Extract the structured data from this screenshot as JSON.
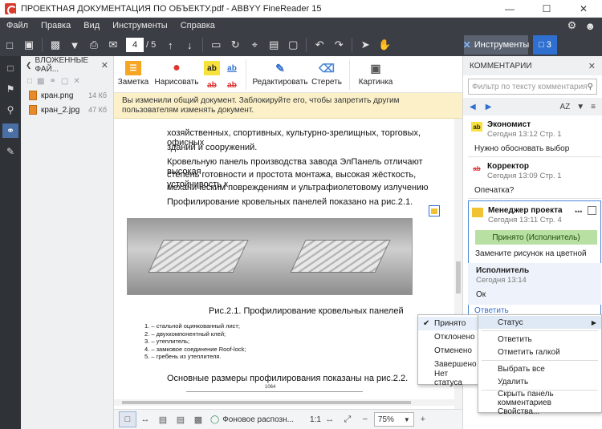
{
  "window": {
    "title": "ПРОЕКТНАЯ ДОКУМЕНТАЦИЯ ПО ОБЪЕКТУ.pdf - ABBYY FineReader 15",
    "minimize": "—",
    "maximize": "☐",
    "close": "✕"
  },
  "menu": {
    "items": [
      "Файл",
      "Правка",
      "Вид",
      "Инструменты",
      "Справка"
    ]
  },
  "toolbar": {
    "page_current": "4",
    "page_total": "/ 5",
    "tools_label": "Инструменты",
    "comments_count": "3"
  },
  "attachments": {
    "title": "ВЛОЖЕННЫЕ ФАЙ...",
    "files": [
      {
        "name": "кран.png",
        "size": "14 Кб"
      },
      {
        "name": "кран_2.jpg",
        "size": "47 Кб"
      }
    ]
  },
  "ribbon": {
    "note": "Заметка",
    "draw": "Нарисовать",
    "edit": "Редактировать",
    "erase": "Стереть",
    "picture": "Картинка",
    "ab": "ab"
  },
  "banner": {
    "text": "Вы изменили общий документ. Заблокируйте его, чтобы запретить другим пользователям изменять документ."
  },
  "document": {
    "line1": "хозяйственных, спортивных, культурно-зрелищных, торговых, офисных",
    "line2": "зданий и сооружений.",
    "line3": "Кровельную панель производства завода ЭлПанель отличают высокая",
    "line4": "степень готовности и простота монтажа, высокая жёсткость, устойчивость к",
    "line5": "механическим повреждениям и ультрафиолетовому излучению",
    "line6": "Профилирование кровельных панелей показано на рис.2.1.",
    "caption": "Рис.2.1.   Профилирование кровельных панелей",
    "legend": [
      "1. – стальной оцинкованный лист;",
      "2. – двухкомпонентный клей;",
      "3. – утеплитель;",
      "4. – замковое соединение Roof-lock;",
      "5. – гребень из утеплителя."
    ],
    "line7": "Основные размеры профилирования показаны на рис.2.2.",
    "ruler_label": "1064"
  },
  "statusbar": {
    "bg_recognition": "Фоновое распозн...",
    "ratio": "1:1",
    "zoom": "75%"
  },
  "comments": {
    "title": "КОММЕНТАРИИ",
    "filter_placeholder": "Фильтр по тексту комментария",
    "sort_label": "AZ",
    "items": [
      {
        "badge": "ab",
        "author": "Экономист",
        "meta": "Сегодня 13:12  Стр. 1",
        "text": "Нужно обосновать выбор"
      },
      {
        "badge": "ab",
        "author": "Корректор",
        "meta": "Сегодня 13:09  Стр. 1",
        "text": "Опечатка?"
      },
      {
        "badge": "",
        "author": "Менеджер проекта",
        "meta": "Сегодня 13:11  Стр. 4",
        "status": "Принято (Исполнитель)",
        "text": "Замените рисунок на цветной",
        "more": "•••"
      }
    ],
    "reply": {
      "author": "Исполнитель",
      "meta": "Сегодня 13:14",
      "text": "Ок"
    },
    "reply_link": "Ответить"
  },
  "status_menu": {
    "items": [
      "Принято",
      "Отклонено",
      "Отменено",
      "Завершено",
      "Нет статуса"
    ],
    "checked": "✔"
  },
  "context_menu": {
    "status": "Статус",
    "reply": "Ответить",
    "mark": "Отметить галкой",
    "select_all": "Выбрать все",
    "delete": "Удалить",
    "hide": "Скрыть панель комментариев",
    "props": "Свойства..."
  },
  "colors": {
    "chrome_dark": "#3b3e44",
    "accent_blue": "#2f6fcf",
    "status_green": "#b9e0a3",
    "banner_yellow": "#fbf0c8",
    "logo_red": "#d83a2c"
  }
}
